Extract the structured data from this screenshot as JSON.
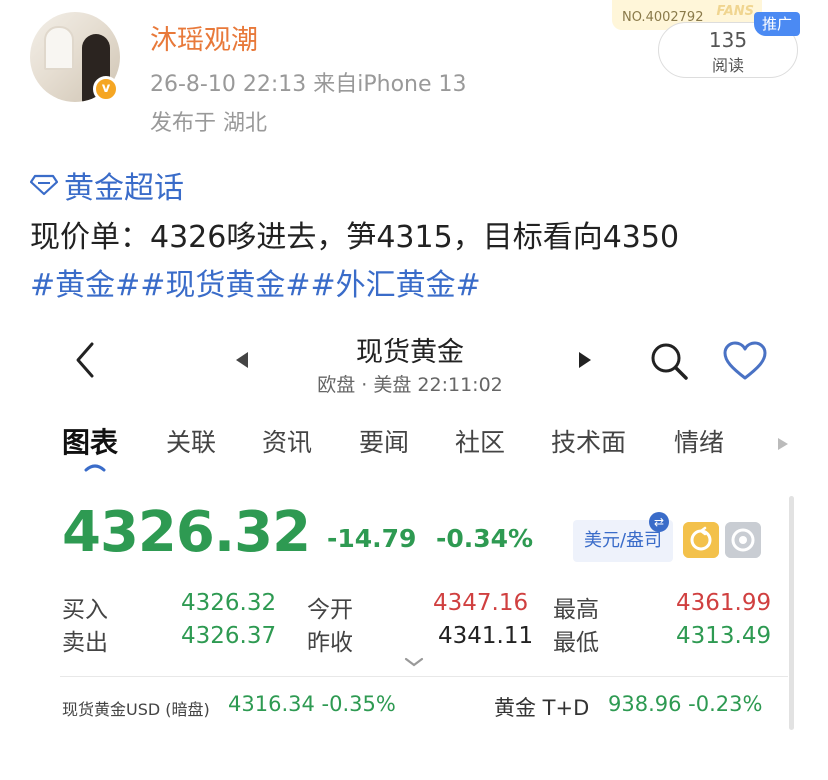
{
  "post": {
    "username": "沐瑶观潮",
    "meta": "26-8-10 22:13  来自iPhone 13",
    "location": "发布于 湖北",
    "reads_count": "135",
    "reads_label": "阅读",
    "promo_badge": "推广",
    "sticker_text": "NO.4002792",
    "sticker_word": "FANS",
    "topic": "黄金超话",
    "content": "现价单：4326哆进去，笋4315，目标看向4350",
    "tags": "#黄金##现货黄金##外汇黄金#"
  },
  "quote": {
    "title": "现货黄金",
    "subtitle": "欧盘 · 美盘 22:11:02",
    "tabs": [
      "图表",
      "关联",
      "资讯",
      "要闻",
      "社区",
      "技术面",
      "情绪"
    ],
    "price": "4326.32",
    "change": "-14.79",
    "change_pct": "-0.34%",
    "unit": "美元/盎司",
    "stats": {
      "buy_label": "买入",
      "buy_value": "4326.32",
      "sell_label": "卖出",
      "sell_value": "4326.37",
      "open_label": "今开",
      "open_value": "4347.16",
      "prev_close_label": "昨收",
      "prev_close_value": "4341.11",
      "high_label": "最高",
      "high_value": "4361.99",
      "low_label": "最低",
      "low_value": "4313.49"
    },
    "footer": {
      "left_label": "现货黄金USD (暗盘)",
      "left_value": "4316.34  -0.35%",
      "right_label": "黄金 T+D",
      "right_value": "938.96  -0.23%"
    }
  },
  "colors": {
    "up": "#d04040",
    "down": "#2e9a52",
    "link": "#3a6cc9",
    "username": "#e8793a"
  }
}
